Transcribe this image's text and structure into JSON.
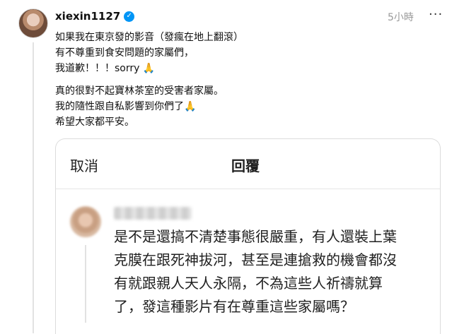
{
  "post": {
    "username": "xiexin1127",
    "verified_icon": "verified-badge-icon",
    "timestamp": "5小時",
    "more_label": "···",
    "caption_lines": [
      "如果我在東京發的影音（發瘋在地上翻滾）",
      "有不尊重到食安問題的家屬們，",
      "我道歉！！！sorry 🙏",
      "真的很對不起寶林茶室的受害者家屬。",
      "我的隨性跟自私影響到你們了🙏",
      "希望大家都平安。"
    ]
  },
  "reply_sheet": {
    "cancel_label": "取消",
    "title": "回覆",
    "comment_lines": [
      "是不是還搞不清楚事態很嚴重，有人還裝上葉",
      "克膜在跟死神拔河，甚至是連搶救的機會都沒",
      "有就跟親人天人永隔，不為這些人祈禱就算",
      "了，發這種影片有在尊重這些家屬嗎？"
    ]
  },
  "colors": {
    "verified": "#0095f6",
    "timestamp": "#999999",
    "text": "#101010"
  }
}
